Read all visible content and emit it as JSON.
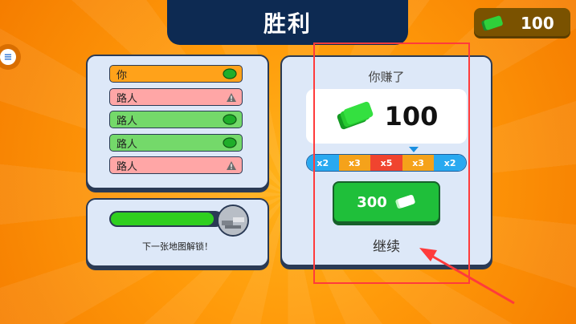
{
  "header": {
    "title": "胜利"
  },
  "currency": {
    "amount": "100",
    "icon": "cash-icon"
  },
  "ranking": {
    "rows": [
      {
        "name": "你",
        "status": "win",
        "icon": "gem-icon"
      },
      {
        "name": "路人",
        "status": "fail",
        "icon": "warning-icon"
      },
      {
        "name": "路人",
        "status": "win",
        "icon": "gem-icon"
      },
      {
        "name": "路人",
        "status": "win",
        "icon": "gem-icon"
      },
      {
        "name": "路人",
        "status": "fail",
        "icon": "warning-icon"
      }
    ]
  },
  "progress": {
    "label": "下一张地图解锁！",
    "fraction": 0.93
  },
  "reward": {
    "earned_label": "你赚了",
    "earned_amount": "100",
    "multipliers": [
      "x2",
      "x3",
      "x5",
      "x3",
      "x2"
    ],
    "ad_button_amount": "300",
    "continue_label": "继续"
  },
  "colors": {
    "accent_orange": "#ff9a0a",
    "banner_navy": "#0d2a52",
    "green": "#1fbf3a",
    "highlight_red": "#ff3b3b"
  }
}
